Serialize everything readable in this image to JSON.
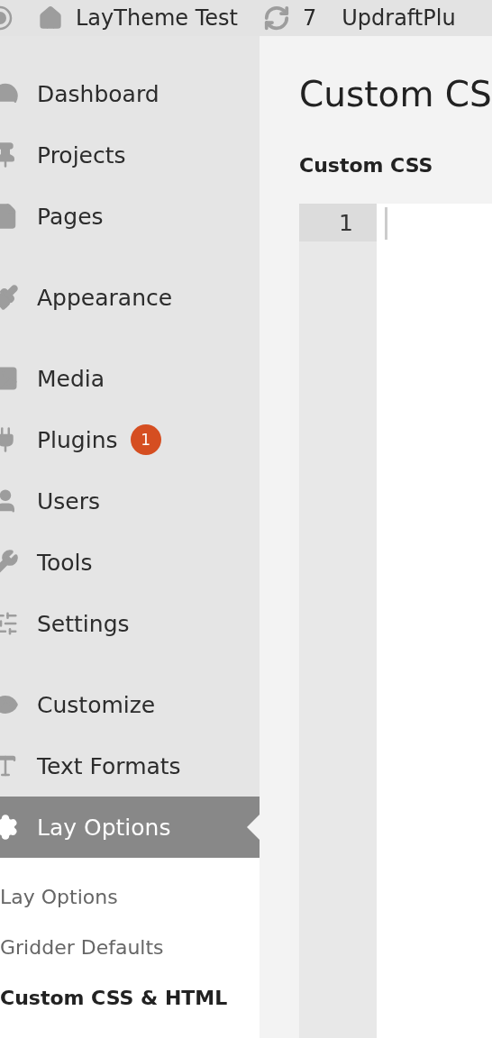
{
  "top_bar": {
    "site_name": "LayTheme Test",
    "updates_count": "7",
    "plugin_link": "UpdraftPlu"
  },
  "sidebar": {
    "groups": [
      {
        "items": [
          {
            "label": "Dashboard",
            "selected": false
          },
          {
            "label": "Projects",
            "selected": false
          },
          {
            "label": "Pages",
            "selected": false
          }
        ]
      },
      {
        "items": [
          {
            "label": "Appearance",
            "selected": false
          }
        ]
      },
      {
        "items": [
          {
            "label": "Media",
            "selected": false
          },
          {
            "label": "Plugins",
            "selected": false,
            "badge": "1"
          },
          {
            "label": "Users",
            "selected": false
          },
          {
            "label": "Tools",
            "selected": false
          },
          {
            "label": "Settings",
            "selected": false
          }
        ]
      },
      {
        "items": [
          {
            "label": "Customize",
            "selected": false
          },
          {
            "label": "Text Formats",
            "selected": false
          },
          {
            "label": "Lay Options",
            "selected": true,
            "submenu": [
              {
                "label": "Lay Options",
                "selected": false
              },
              {
                "label": "Gridder Defaults",
                "selected": false
              },
              {
                "label": "Custom CSS & HTML",
                "selected": true
              }
            ]
          }
        ]
      }
    ]
  },
  "main": {
    "title": "Custom CS",
    "section_label": "Custom CSS",
    "editor": {
      "line_numbers": [
        "1"
      ]
    }
  }
}
